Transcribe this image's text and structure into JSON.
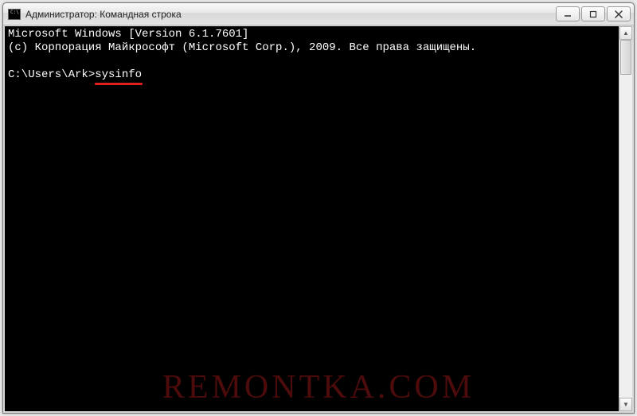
{
  "window": {
    "title": "Администратор: Командная строка",
    "icon_label": "C:\\"
  },
  "controls": {
    "minimize": "—",
    "maximize": "❐",
    "close": "✕"
  },
  "terminal": {
    "line1": "Microsoft Windows [Version 6.1.7601]",
    "line2": "(c) Корпорация Майкрософт (Microsoft Corp.), 2009. Все права защищены.",
    "blank": "",
    "prompt": "C:\\Users\\Ark>",
    "command": "sysinfo"
  },
  "scrollbar": {
    "up": "▲",
    "down": "▼"
  },
  "watermark": "REMONTKA.COM"
}
